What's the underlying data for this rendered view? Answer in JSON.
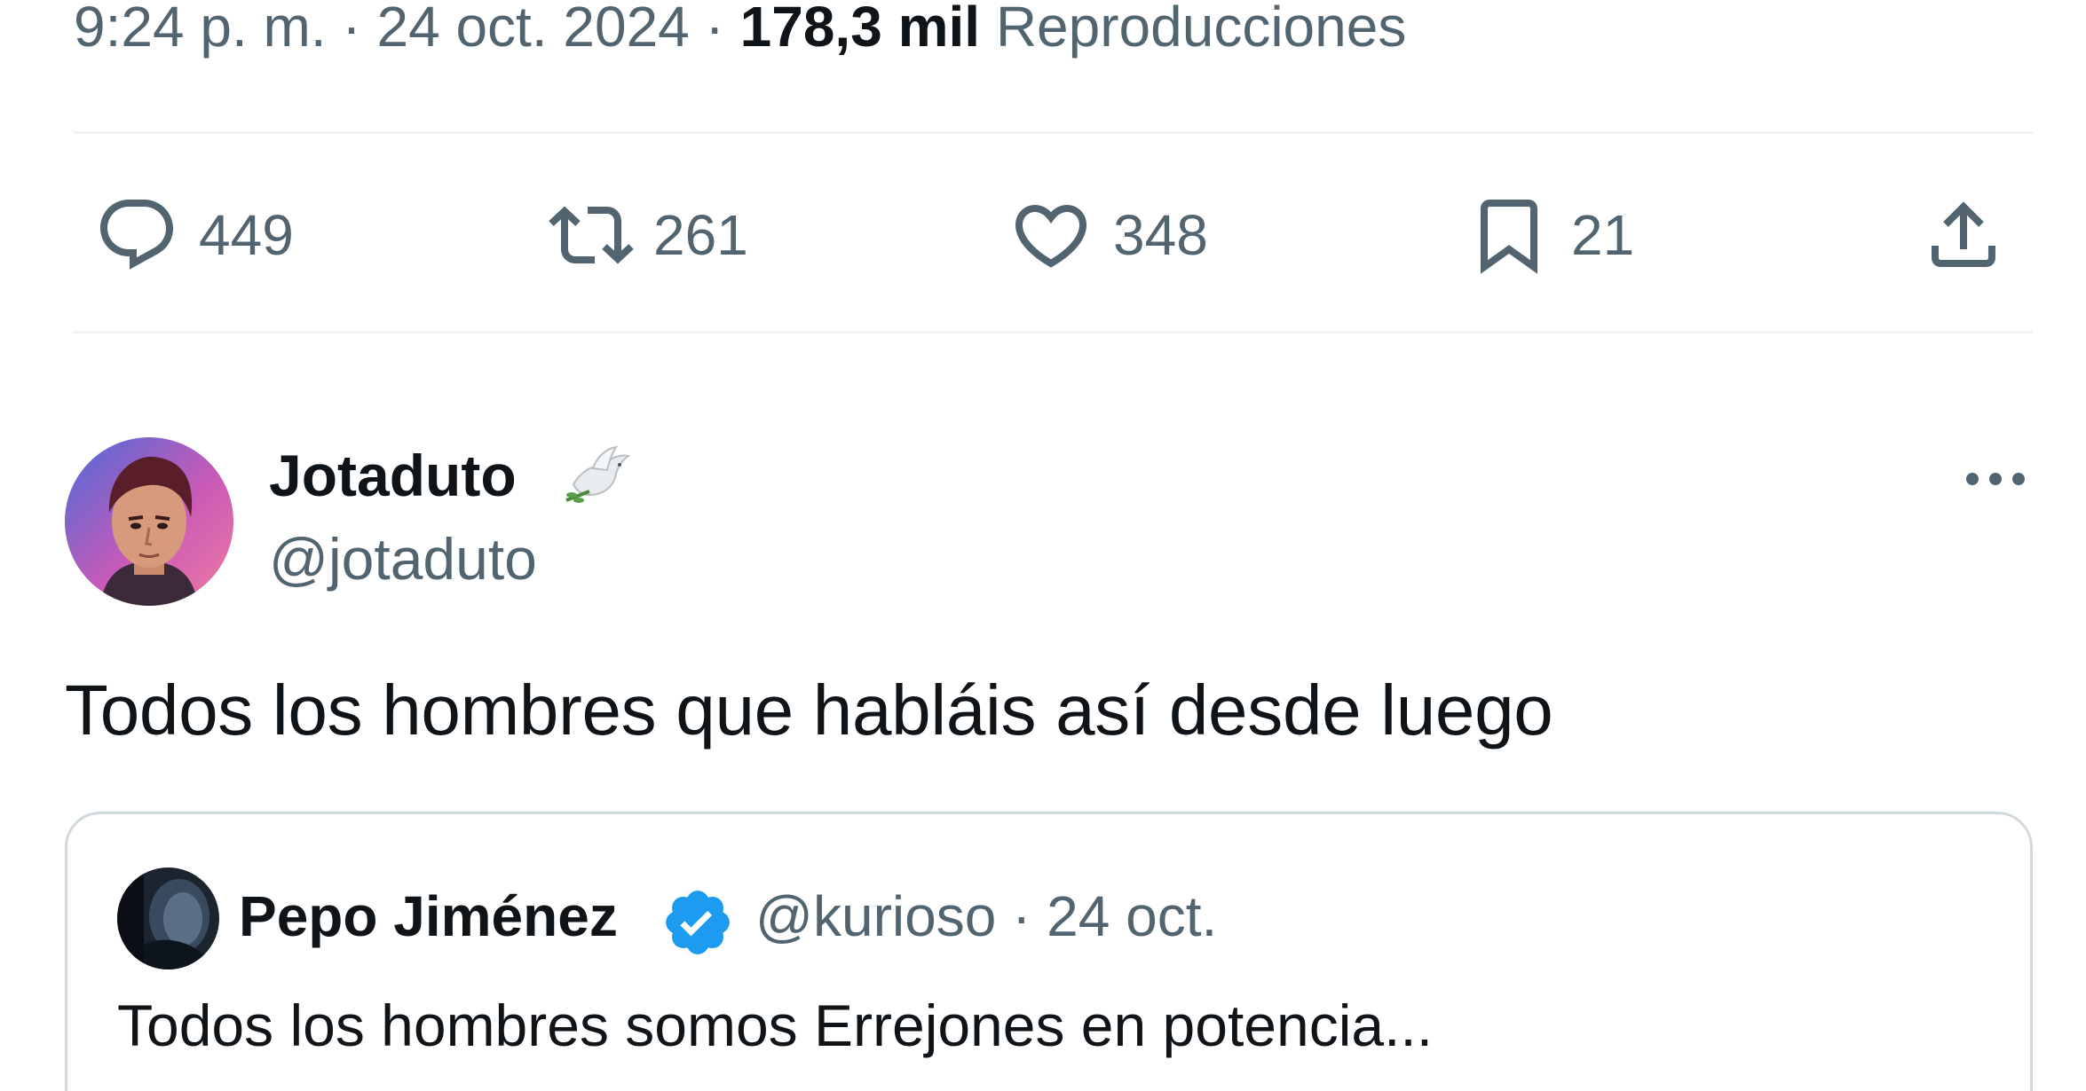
{
  "meta": {
    "time": "9:24 p. m.",
    "separator": "·",
    "date": "24 oct. 2024",
    "views_count": "178,3 mil",
    "views_label": "Reproducciones"
  },
  "actions": {
    "replies": "449",
    "retweets": "261",
    "likes": "348",
    "bookmarks": "21"
  },
  "reply": {
    "display_name": "Jotaduto",
    "handle": "@jotaduto",
    "text": "Todos los hombres que habláis así desde luego"
  },
  "quote": {
    "display_name": "Pepo Jiménez",
    "handle": "@kurioso",
    "separator": "·",
    "date": "24 oct.",
    "text": "Todos los hombres somos Errejones en potencia..."
  },
  "colors": {
    "text": "#0f1419",
    "secondary": "#536471",
    "divider": "#eff3f4",
    "verified": "#1d9bf0"
  }
}
